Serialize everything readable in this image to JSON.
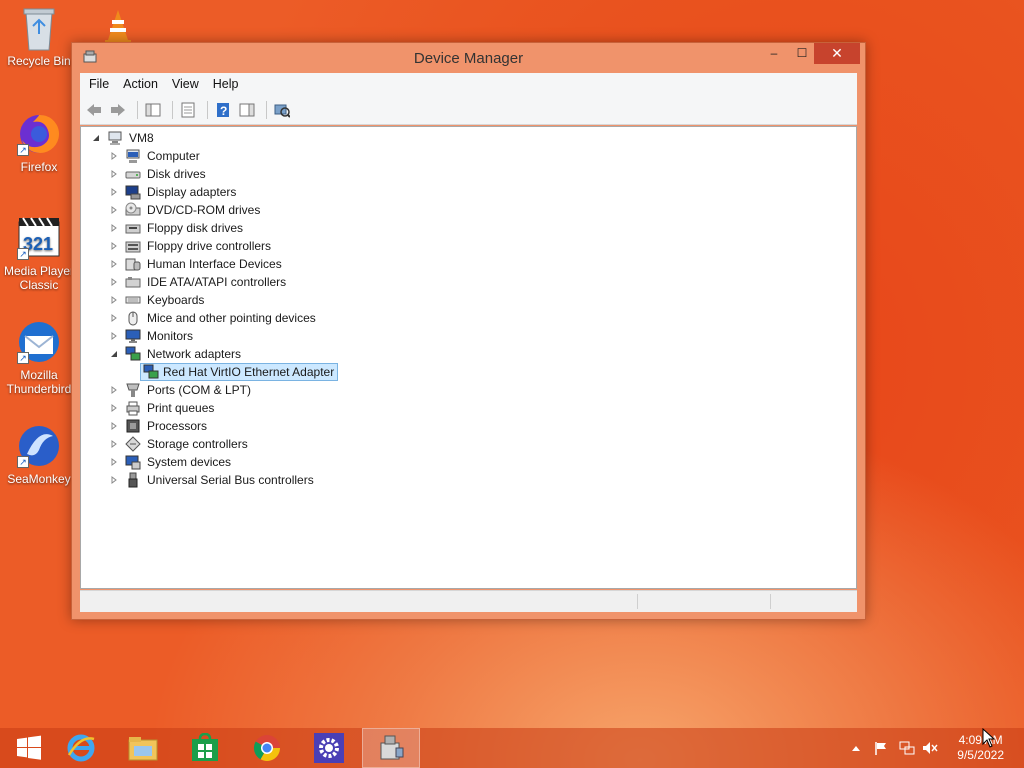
{
  "desktop": {
    "icons": [
      {
        "label": "Recycle Bin"
      },
      {
        "label": "Firefox"
      },
      {
        "label": "Media Player Classic"
      },
      {
        "label": "Mozilla Thunderbird"
      },
      {
        "label": "SeaMonkey"
      }
    ]
  },
  "window": {
    "title": "Device Manager",
    "controls": {
      "minimize": "–",
      "maximize": "☐",
      "close": "✕"
    },
    "menu": [
      "File",
      "Action",
      "View",
      "Help"
    ]
  },
  "tree": {
    "root": "VM8",
    "categories": [
      {
        "label": "Computer",
        "icon": "computer-icon"
      },
      {
        "label": "Disk drives",
        "icon": "disk-drive-icon"
      },
      {
        "label": "Display adapters",
        "icon": "display-adapter-icon"
      },
      {
        "label": "DVD/CD-ROM drives",
        "icon": "dvd-drive-icon"
      },
      {
        "label": "Floppy disk drives",
        "icon": "floppy-disk-icon"
      },
      {
        "label": "Floppy drive controllers",
        "icon": "floppy-controller-icon"
      },
      {
        "label": "Human Interface Devices",
        "icon": "hid-icon"
      },
      {
        "label": "IDE ATA/ATAPI controllers",
        "icon": "ide-controller-icon"
      },
      {
        "label": "Keyboards",
        "icon": "keyboard-icon"
      },
      {
        "label": "Mice and other pointing devices",
        "icon": "mouse-icon"
      },
      {
        "label": "Monitors",
        "icon": "monitor-icon"
      },
      {
        "label": "Network adapters",
        "icon": "network-adapter-icon",
        "expanded": true,
        "children": [
          {
            "label": "Red Hat VirtIO Ethernet Adapter",
            "selected": true
          }
        ]
      },
      {
        "label": "Ports (COM & LPT)",
        "icon": "port-icon"
      },
      {
        "label": "Print queues",
        "icon": "printer-icon"
      },
      {
        "label": "Processors",
        "icon": "processor-icon"
      },
      {
        "label": "Storage controllers",
        "icon": "storage-controller-icon"
      },
      {
        "label": "System devices",
        "icon": "system-device-icon"
      },
      {
        "label": "Universal Serial Bus controllers",
        "icon": "usb-icon"
      }
    ]
  },
  "taskbar": {
    "clock_time": "4:09 AM",
    "clock_date": "9/5/2022"
  },
  "colors": {
    "selection_bg": "#cce8ff",
    "selection_border": "#7ab3e2",
    "close_button": "#c7432d",
    "window_frame": "#f0936b"
  }
}
